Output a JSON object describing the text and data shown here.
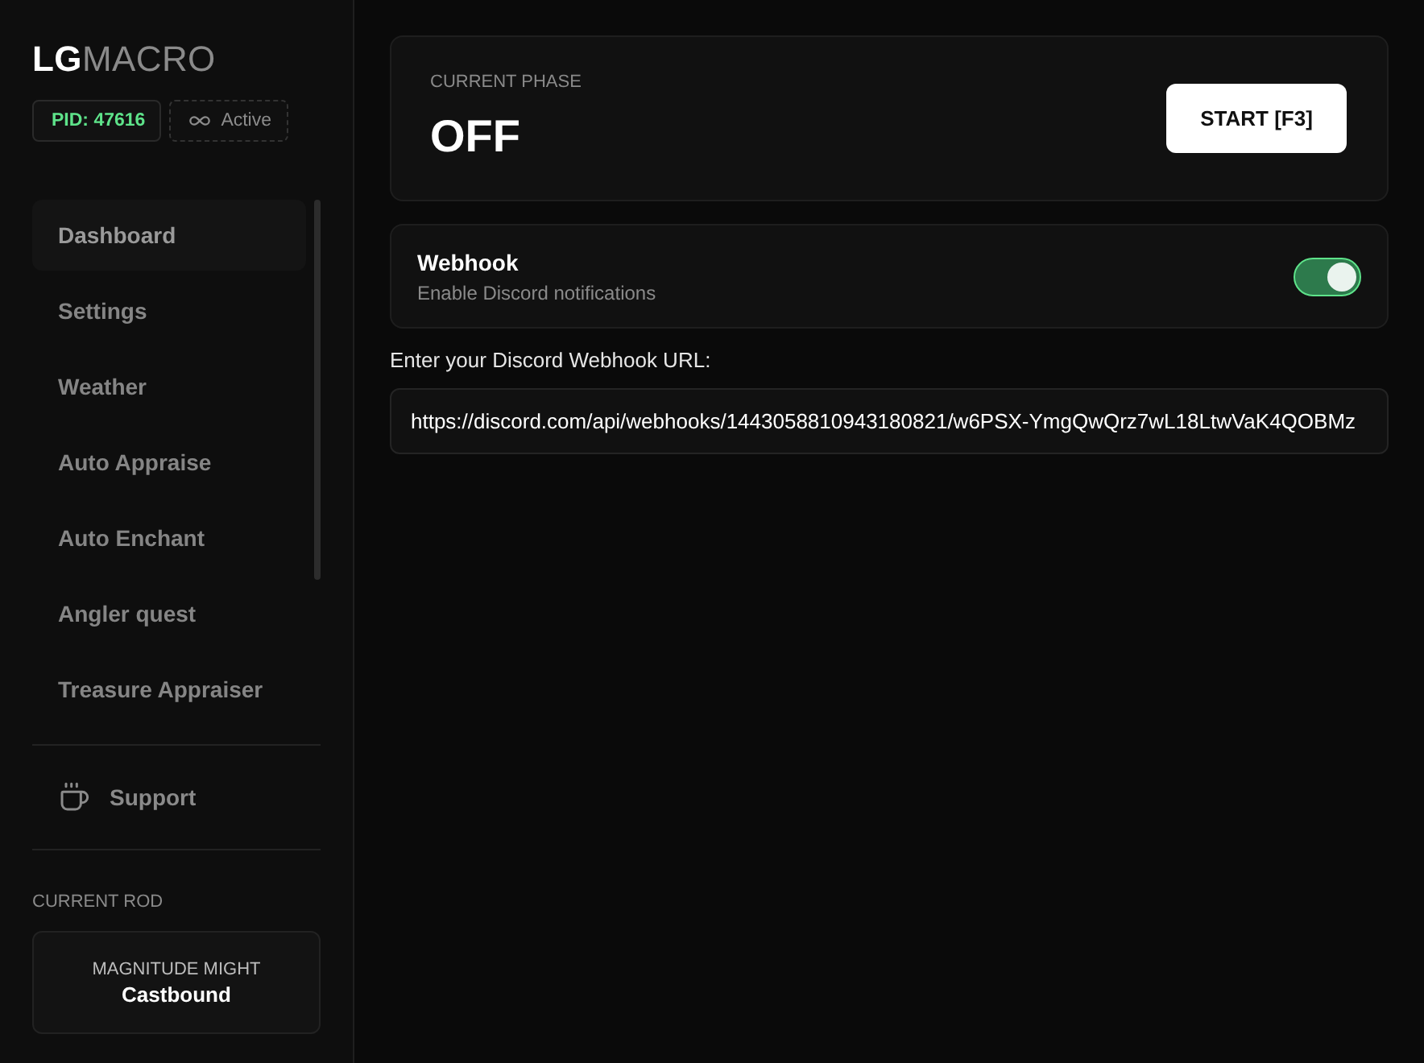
{
  "logo": {
    "primary": "LG",
    "secondary": "MACRO"
  },
  "badges": [
    {
      "kind": "pid",
      "label": "PID: 47616"
    },
    {
      "kind": "status",
      "label": "Active"
    }
  ],
  "sidebar": {
    "items": [
      {
        "label": "Dashboard",
        "selected": true
      },
      {
        "label": "Settings",
        "selected": false
      },
      {
        "label": "Weather",
        "selected": false
      },
      {
        "label": "Auto Appraise",
        "selected": false
      },
      {
        "label": "Auto Enchant",
        "selected": false
      },
      {
        "label": "Angler quest",
        "selected": false
      },
      {
        "label": "Treasure Appraiser",
        "selected": false
      }
    ],
    "support": {
      "label": "Support"
    },
    "current_rod": {
      "heading": "CURRENT ROD",
      "name": "MAGNITUDE MIGHT",
      "subtitle": "Castbound"
    }
  },
  "phase_card": {
    "label": "CURRENT PHASE",
    "value": "OFF",
    "button": "START [F3]"
  },
  "webhook": {
    "title": "Webhook",
    "description": "Enable Discord notifications",
    "on": true
  },
  "url_field": {
    "label": "Enter your Discord Webhook URL:",
    "value": "https://discord.com/api/webhooks/1443058810943180821/w6PSX-YmgQwQrz7wL18LtwVaK4QOBMz"
  }
}
